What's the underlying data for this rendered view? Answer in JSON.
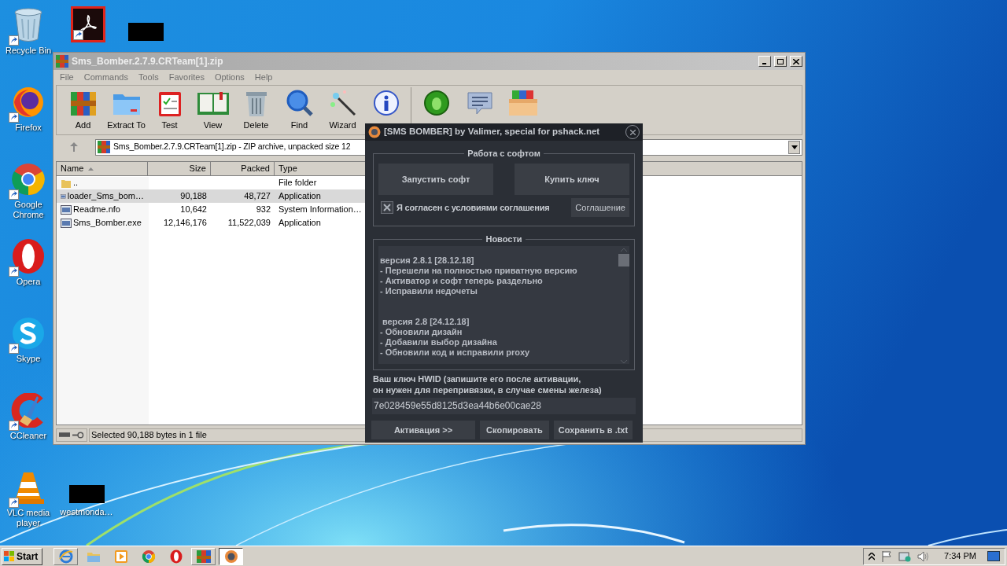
{
  "desktop": {
    "icons": [
      {
        "label": "Recycle Bin"
      },
      {
        "label": "Firefox"
      },
      {
        "label": "Google Chrome"
      },
      {
        "label": "Opera"
      },
      {
        "label": "Skype"
      },
      {
        "label": "CCleaner"
      },
      {
        "label": "VLC media player"
      }
    ],
    "redacted_icon": {
      "label": "westmonda…"
    }
  },
  "archiver": {
    "title": "Sms_Bomber.2.7.9.CRTeam[1].zip",
    "menu": [
      "File",
      "Commands",
      "Tools",
      "Favorites",
      "Options",
      "Help"
    ],
    "toolbar": [
      {
        "label": "Add"
      },
      {
        "label": "Extract To"
      },
      {
        "label": "Test"
      },
      {
        "label": "View"
      },
      {
        "label": "Delete"
      },
      {
        "label": "Find"
      },
      {
        "label": "Wizard"
      }
    ],
    "address": "Sms_Bomber.2.7.9.CRTeam[1].zip - ZIP archive, unpacked size 12",
    "columns": [
      "Name",
      "Size",
      "Packed",
      "Type"
    ],
    "rows": [
      {
        "name": "..",
        "type": "File folder",
        "selected": false
      },
      {
        "name": "loader_Sms_bom…",
        "size": "90,188",
        "packed": "48,727",
        "type": "Application",
        "selected": true
      },
      {
        "name": "Readme.nfo",
        "size": "10,642",
        "packed": "932",
        "type": "System Information…",
        "selected": false
      },
      {
        "name": "Sms_Bomber.exe",
        "size": "12,146,176",
        "packed": "11,522,039",
        "type": "Application",
        "selected": false
      }
    ],
    "status": "Selected 90,188 bytes in 1 file"
  },
  "dialog": {
    "title": "[SMS BOMBER] by Valimer, special for pshack.net",
    "software_group": "Работа с софтом",
    "buttons": [
      "Запустить софт",
      "Купить ключ"
    ],
    "agree": {
      "label": "Я согласен с условиями соглашения",
      "checked": true
    },
    "agreement_button": "Соглашение",
    "news_group": "Новости",
    "news": [
      {
        "heading": "версия 2.8.1 [28.12.18]",
        "items": [
          "- Перешели на полностью приватную версию",
          "- Активатор и софт теперь раздельно",
          "- Исправили недочеты"
        ]
      },
      {
        "heading": "версия 2.8 [24.12.18]",
        "items": [
          "- Обновили дизайн",
          "- Добавили выбор дизайна",
          "- Обновили код и исправили proxy"
        ]
      }
    ],
    "hwid_label": [
      "Ваш ключ HWID (запишите его после активации,",
      "он нужен для перепривязки, в случае смены железа)"
    ],
    "hwid": "7e028459e55d8125d3ea44b6e00cae28",
    "bottom_buttons": [
      "Активация >>",
      "Скопировать",
      "Сохранить в .txt"
    ]
  },
  "taskbar": {
    "start": "Start",
    "apps": [
      {
        "selected": false
      },
      {
        "selected": false
      },
      {
        "selected": false
      },
      {
        "selected": false
      },
      {
        "selected": false
      },
      {
        "selected": false
      },
      {
        "selected": true
      }
    ],
    "time": "7:34 PM"
  }
}
